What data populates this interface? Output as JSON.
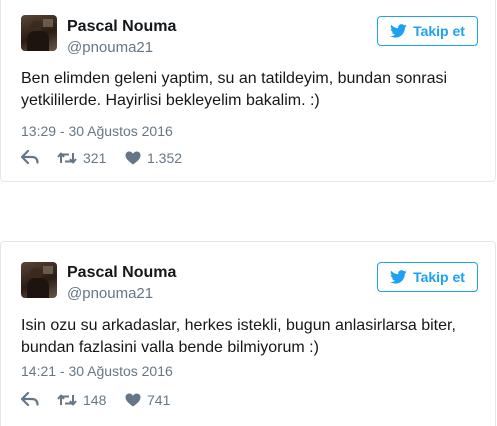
{
  "tweets": [
    {
      "author": {
        "name": "Pascal Nouma",
        "handle": "@pnouma21"
      },
      "follow_label": "Takip et",
      "text_lines": [
        "Ben elimden geleni yaptim, su an tatildeyim, bundan sonrasi",
        "yetkililerde. Hayirlisi bekleyelim bakalim. :)"
      ],
      "timestamp": "13:29 - 30 Ağustos 2016",
      "retweets": "321",
      "likes": "1.352"
    },
    {
      "author": {
        "name": "Pascal Nouma",
        "handle": "@pnouma21"
      },
      "follow_label": "Takip et",
      "text_lines": [
        "Isin ozu su arkadaslar, herkes istekli, bugun anlasirlarsa biter,",
        "bundan fazlasini valla bende bilmiyorum :)"
      ],
      "timestamp": "14:21 - 30 Ağustos 2016",
      "retweets": "148",
      "likes": "741"
    }
  ],
  "icons": {
    "follow": "twitter-bird-icon",
    "reply": "reply-arrow-icon",
    "retweet": "retweet-icon",
    "like": "heart-icon"
  },
  "colors": {
    "accent": "#1da1f2",
    "secondary_text": "#657786",
    "border": "#e1e8ed"
  }
}
